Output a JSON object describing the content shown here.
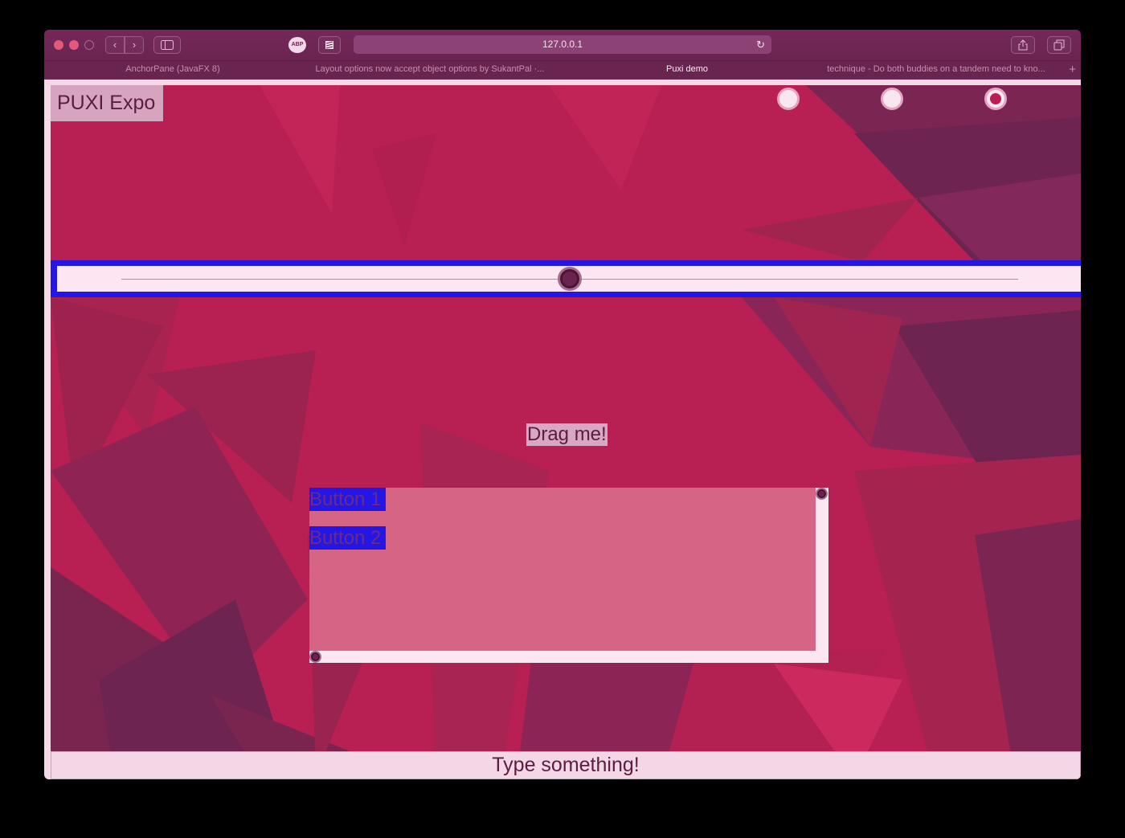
{
  "toolbar": {
    "url": "127.0.0.1",
    "extension_label": "ABP"
  },
  "tabs": [
    {
      "label": "AnchorPane (JavaFX 8)",
      "active": false
    },
    {
      "label": "Layout options now accept object options by SukantPal ·...",
      "active": false
    },
    {
      "label": "Puxi demo",
      "active": true
    },
    {
      "label": "technique - Do both buddies on a tandem need to kno...",
      "active": false
    }
  ],
  "app": {
    "logo_text": "PUXI Expo",
    "radios": [
      {
        "checked": false
      },
      {
        "checked": false
      },
      {
        "checked": true
      }
    ],
    "slider_value": 0.5,
    "drag_label": "Drag me!",
    "buttons": [
      "Button 1",
      "Button 2"
    ],
    "text_input_placeholder": "Type something!"
  },
  "colors": {
    "background": "#b81f52",
    "accent_blue": "#2416e4",
    "chrome": "#6a2450",
    "panel": "#d66485"
  }
}
